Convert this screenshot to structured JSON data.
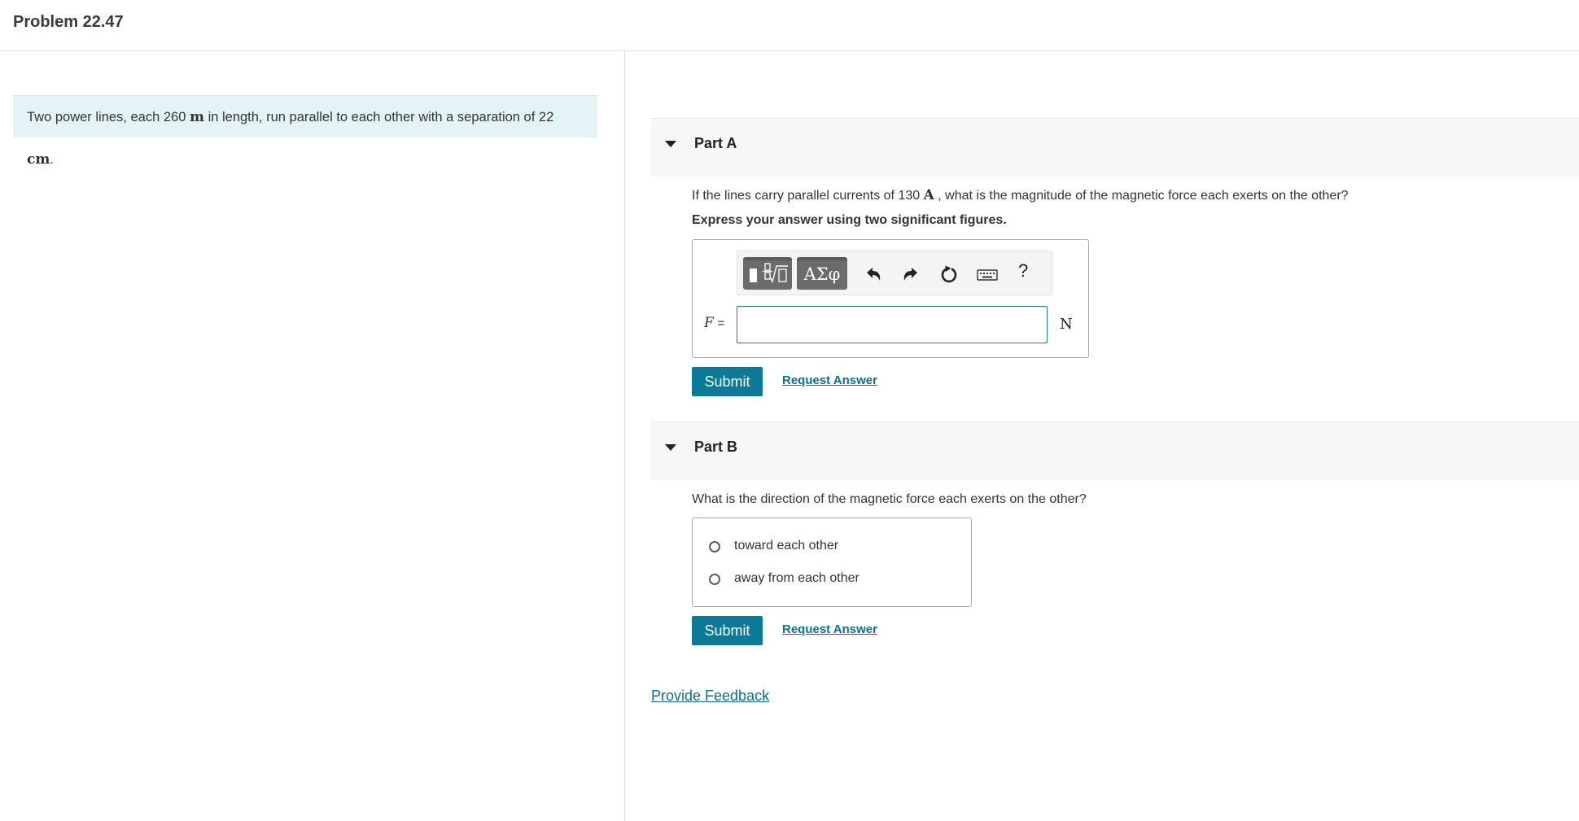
{
  "header": {
    "title": "Problem 22.47"
  },
  "statement": {
    "text_before_length": "Two power lines, each 260",
    "length_unit": "m",
    "text_before_separation": "in length, run parallel to each other with a separation of 22",
    "separation_unit": "cm",
    "period": "."
  },
  "part_a": {
    "label": "Part A",
    "question_before_unit": "If the lines carry parallel currents of 130",
    "current_unit": "A",
    "question_after_unit": ", what is the magnitude of the magnetic force each exerts on the other?",
    "instruction": "Express your answer using two significant figures.",
    "toolbar": {
      "templates_icon": "templates-icon",
      "symbols_label": "ΑΣφ",
      "undo_icon": "undo-icon",
      "redo_icon": "redo-icon",
      "reset_icon": "reset-icon",
      "keyboard_icon": "keyboard-icon",
      "help_label": "?"
    },
    "variable": "F",
    "equals": "=",
    "input_value": "",
    "unit": "N",
    "submit_label": "Submit",
    "request_answer_label": "Request Answer"
  },
  "part_b": {
    "label": "Part B",
    "question": "What is the direction of the magnetic force each exerts on the other?",
    "options": [
      {
        "label": "toward each other",
        "selected": false
      },
      {
        "label": "away from each other",
        "selected": false
      }
    ],
    "submit_label": "Submit",
    "request_answer_label": "Request Answer"
  },
  "feedback_label": "Provide Feedback",
  "colors": {
    "accent": "#0b7a99",
    "link": "#0b6f8e",
    "statement_bg": "#e4f4f6",
    "toolbar_button": "#6b6b6b"
  }
}
